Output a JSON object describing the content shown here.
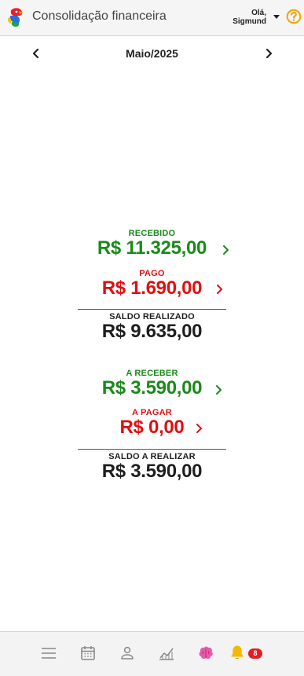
{
  "header": {
    "title": "Consolidação financeira",
    "greeting_line1": "Olá,",
    "greeting_line2": "Sigmund",
    "logo_icon": "parrot-logo-icon",
    "help_icon": "question-circle-icon",
    "accent": "#f5a000"
  },
  "month_nav": {
    "label": "Maio/2025",
    "prev_icon": "chevron-left-icon",
    "next_icon": "chevron-right-icon"
  },
  "realized": {
    "received_label": "RECEBIDO",
    "received_value": "R$ 11.325,00",
    "paid_label": "PAGO",
    "paid_value": "R$ 1.690,00",
    "balance_label": "SALDO REALIZADO",
    "balance_value": "R$ 9.635,00"
  },
  "pending": {
    "receivable_label": "A RECEBER",
    "receivable_value": "R$ 3.590,00",
    "payable_label": "A PAGAR",
    "payable_value": "R$ 0,00",
    "balance_label": "SALDO A REALIZAR",
    "balance_value": "R$ 3.590,00"
  },
  "colors": {
    "positive": "#1a8a1a",
    "negative": "#e01010",
    "neutral": "#1e1e1e"
  },
  "bottom_nav": {
    "items": [
      "menu-icon",
      "calendar-icon",
      "person-icon",
      "chart-line-icon",
      "brain-icon",
      "bell-icon"
    ],
    "notification_count": "8"
  }
}
